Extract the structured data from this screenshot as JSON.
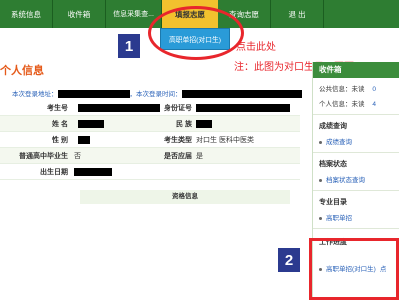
{
  "nav": {
    "items": [
      "系统信息",
      "收件箱",
      "信息采集查...",
      "填报志愿",
      "查询志愿",
      "退 出"
    ],
    "active_index": 3
  },
  "dropdown": {
    "label": "高职单招(对口生)"
  },
  "annotations": {
    "badge1": "1",
    "badge2": "2",
    "click_here": "点击此处",
    "note": "注：此图为对口生显示页面"
  },
  "page": {
    "heading": "个人信息"
  },
  "login": {
    "last_login_addr_label": "本次登录地址：",
    "last_login_time_label": "，本次登录时间："
  },
  "fields": {
    "exam_no_label": "考生号",
    "id_no_label": "身份证号",
    "name_label": "姓 名",
    "ethnicity_label": "民 族",
    "gender_label": "性 别",
    "exam_type_label": "考生类型",
    "exam_type_value": "对口生 医科中医类",
    "hs_grad_label": "普通高中毕业生",
    "hs_grad_value": "否",
    "confirmed_label": "是否应届",
    "confirmed_value": "是",
    "dob_label": "出生日期",
    "qualification_title": "资格信息"
  },
  "sidebar": {
    "inbox_title": "收件箱",
    "public_msg_label": "公共信息：未读",
    "public_msg_count": "0",
    "personal_msg_label": "个人信息：未读",
    "personal_msg_count": "4",
    "score_title": "成绩查询",
    "score_link": "成绩查询",
    "archive_title": "档案状态",
    "archive_link": "档案状态查询",
    "major_title": "专业目录",
    "major_link": "高职单招",
    "progress_title": "工作进度",
    "progress_link": "高职单招(对口生)",
    "progress_suffix": "点"
  },
  "colors": {
    "nav_bg": "#2e7d32",
    "nav_active": "#f2c12e",
    "dropdown_bg": "#2a9bd8",
    "annotation_red": "#e8262c",
    "badge_blue": "#2b3a8f"
  }
}
